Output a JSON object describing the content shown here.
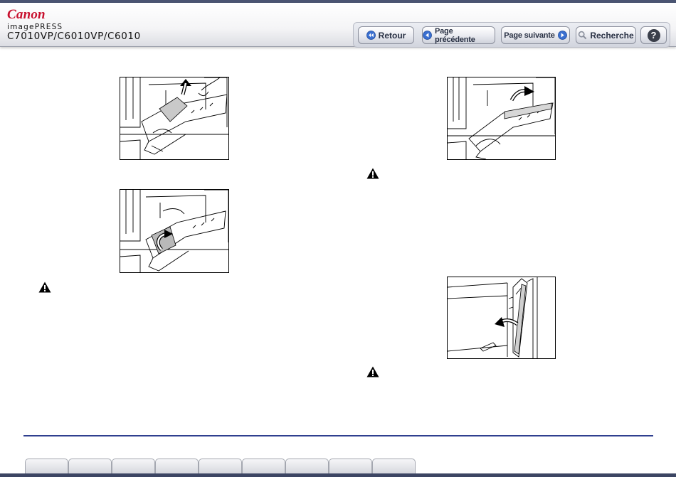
{
  "header": {
    "brand": "Canon",
    "product": "imagePRESS",
    "models": "C7010VP/C6010VP/C6010"
  },
  "nav": {
    "back_label": "Retour",
    "prev_label": "Page précédente",
    "next_label": "Page suivante",
    "search_label": "Recherche",
    "help_label": "?"
  },
  "icons": {
    "back": "rewind-icon",
    "prev": "arrow-left-icon",
    "next": "arrow-right-icon",
    "search": "magnifier-icon",
    "help": "question-icon",
    "warning": "warning-triangle-icon"
  },
  "colors": {
    "brand_red": "#c8102e",
    "rule_blue": "#2f3f8f",
    "nav_icon_blue": "#3a6fd0"
  },
  "bottom_tabs": [
    "",
    "",
    "",
    "",
    "",
    "",
    "",
    "",
    "",
    ""
  ]
}
